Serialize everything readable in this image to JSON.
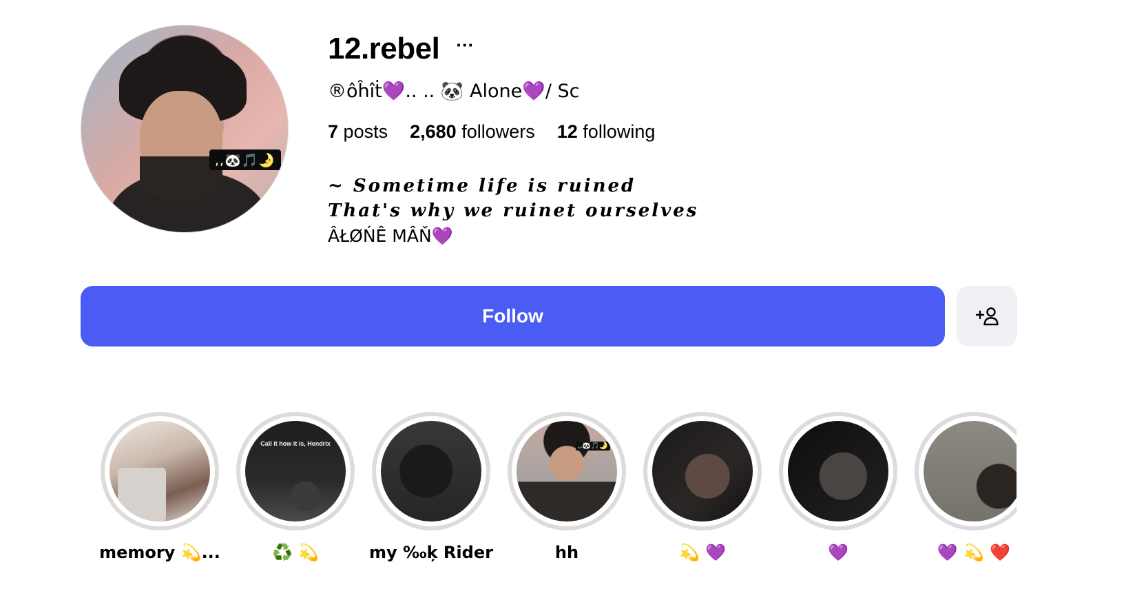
{
  "profile": {
    "username": "12.rebel",
    "more_label": "···",
    "full_name": "®ôĥîṫ💜.. .. 🐼 Alone💜/ Sc",
    "avatar_sticker": ",,🐼🎵🌛",
    "stats": [
      {
        "value": "7",
        "label": "posts"
      },
      {
        "value": "2,680",
        "label": "followers"
      },
      {
        "value": "12",
        "label": "following"
      }
    ],
    "bio": {
      "line1": "~ Sometime life is ruined",
      "line2": "That's why we ruinet ourselves",
      "line3": "ÂŁØŃÊ MÂŇ💜"
    }
  },
  "actions": {
    "follow_label": "Follow",
    "follow_color": "#4b5cf5",
    "suggest_icon": "add-person-icon"
  },
  "highlights": [
    {
      "label": "memory 💫..."
    },
    {
      "label": "♻️ 💫",
      "thumb_text": "Call it how it is, Hendrix"
    },
    {
      "label": "my ‰ķ Rider"
    },
    {
      "label": "hh",
      "thumb_text": ",,🐼🎵🌛"
    },
    {
      "label": "💫 💜"
    },
    {
      "label": "💜"
    },
    {
      "label": "💜 💫 ❤️"
    }
  ]
}
